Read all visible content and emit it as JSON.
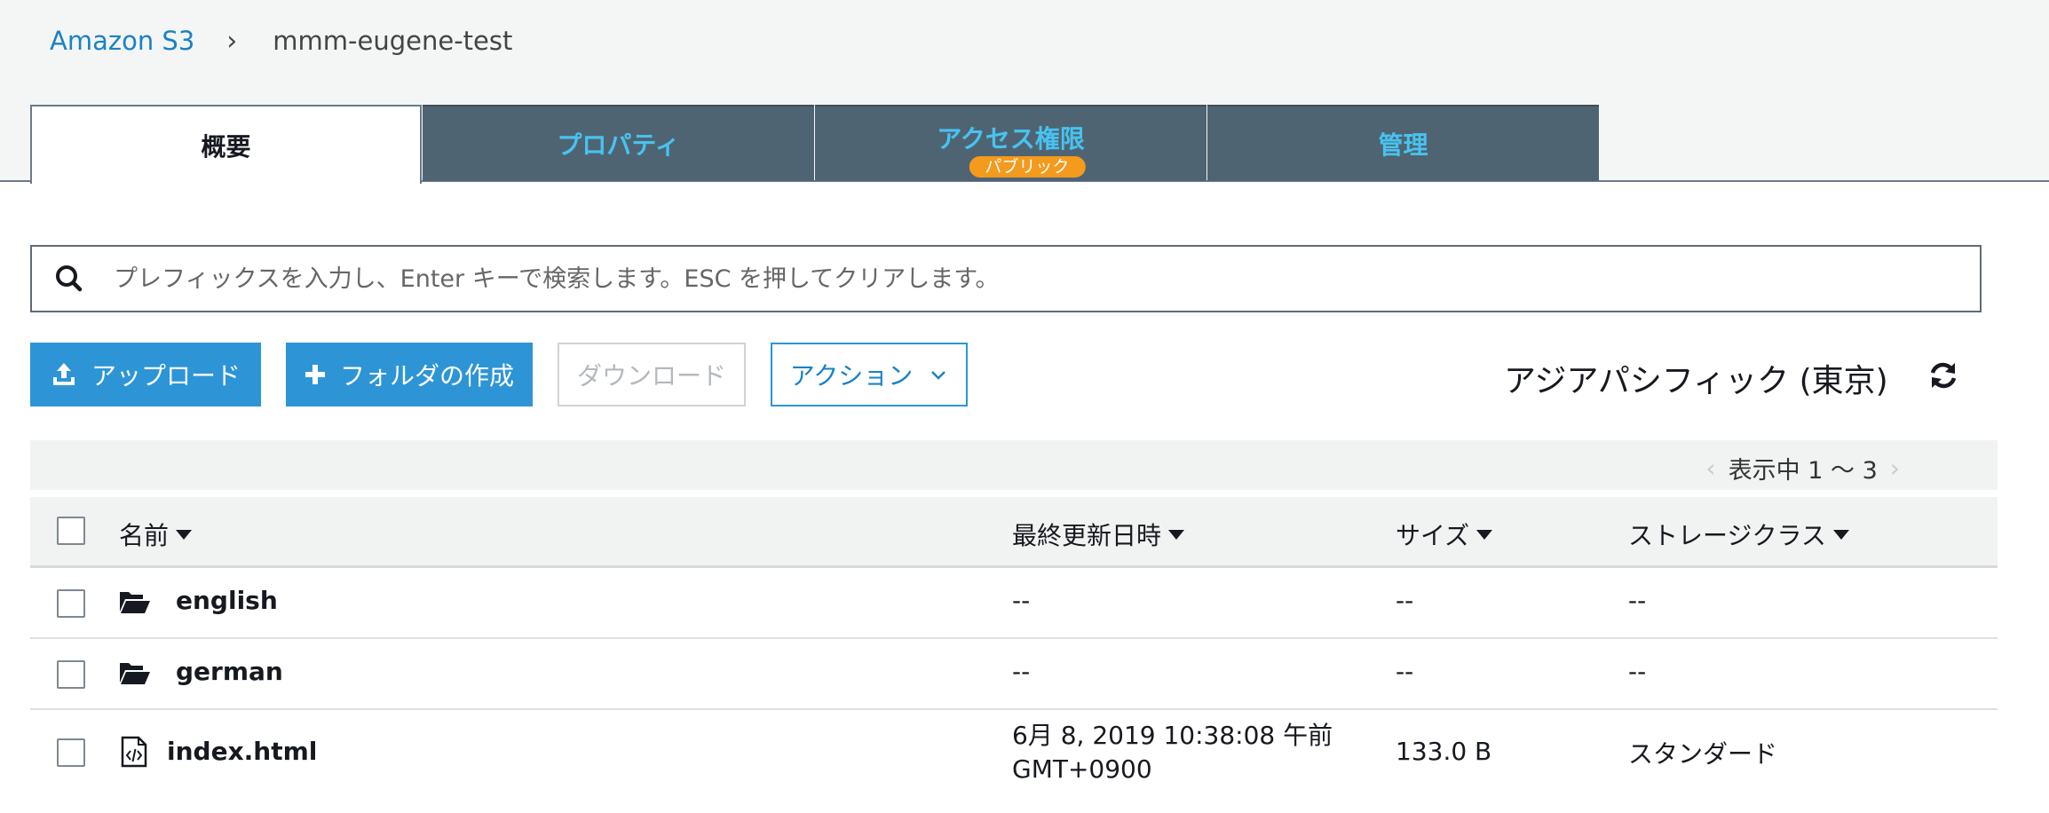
{
  "breadcrumb": {
    "root": "Amazon S3",
    "separator": "›",
    "bucket": "mmm-eugene-test"
  },
  "tabs": [
    {
      "label": "概要",
      "active": true
    },
    {
      "label": "プロパティ",
      "active": false
    },
    {
      "label": "アクセス権限",
      "active": false,
      "badge": "パブリック"
    },
    {
      "label": "管理",
      "active": false
    }
  ],
  "search": {
    "placeholder": "プレフィックスを入力し、Enter キーで検索します。ESC を押してクリアします。"
  },
  "toolbar": {
    "upload_label": "アップロード",
    "create_folder_label": "フォルダの作成",
    "download_label": "ダウンロード",
    "actions_label": "アクション",
    "region": "アジアパシフィック (東京)"
  },
  "pager": {
    "text": "表示中 1 〜 3",
    "prev": "‹",
    "next": "›"
  },
  "table": {
    "columns": [
      "名前",
      "最終更新日時",
      "サイズ",
      "ストレージクラス"
    ],
    "rows": [
      {
        "name": "english",
        "type": "folder-icon",
        "modified": "--",
        "modified_line2": "",
        "size": "--",
        "storage_class": "--"
      },
      {
        "name": "german",
        "type": "folder-icon",
        "modified": "--",
        "modified_line2": "",
        "size": "--",
        "storage_class": "--"
      },
      {
        "name": "index.html",
        "type": "code-file-icon",
        "modified": "6月 8, 2019 10:38:08 午前",
        "modified_line2": "GMT+0900",
        "size": "133.0 B",
        "storage_class": "スタンダード"
      }
    ]
  },
  "colors": {
    "primary": "#2d95d6",
    "tab_bg": "#4f6472",
    "tab_text": "#47c3f0",
    "badge": "#f49a1c",
    "link": "#1a82c4"
  }
}
